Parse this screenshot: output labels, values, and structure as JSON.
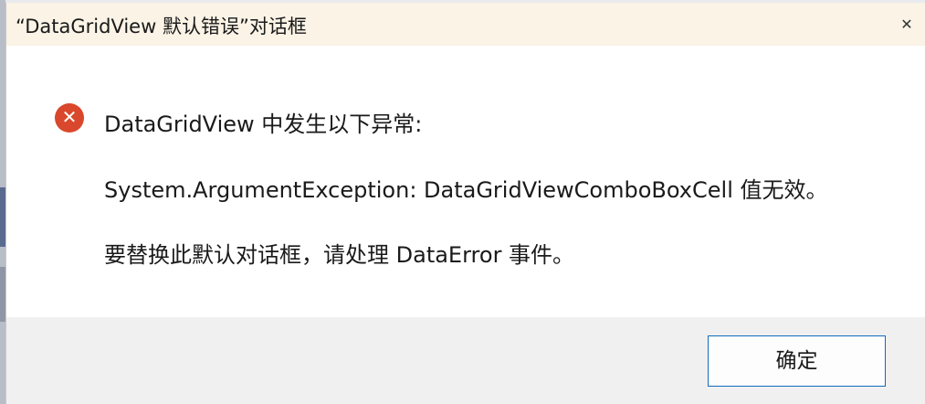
{
  "dialog": {
    "title": "“DataGridView 默认错误”对话框",
    "close_glyph": "✕",
    "icon": "error-icon",
    "message_line1": "DataGridView 中发生以下异常:",
    "message_line2": "System.ArgumentException: DataGridViewComboBoxCell 值无效。",
    "message_line3": "要替换此默认对话框，请处理 DataError 事件。",
    "ok_label": "确定"
  },
  "colors": {
    "title_bar": "#faf3e6",
    "error_icon": "#d9482c",
    "footer": "#f0f0f0",
    "button_border": "#0f6cbd"
  }
}
